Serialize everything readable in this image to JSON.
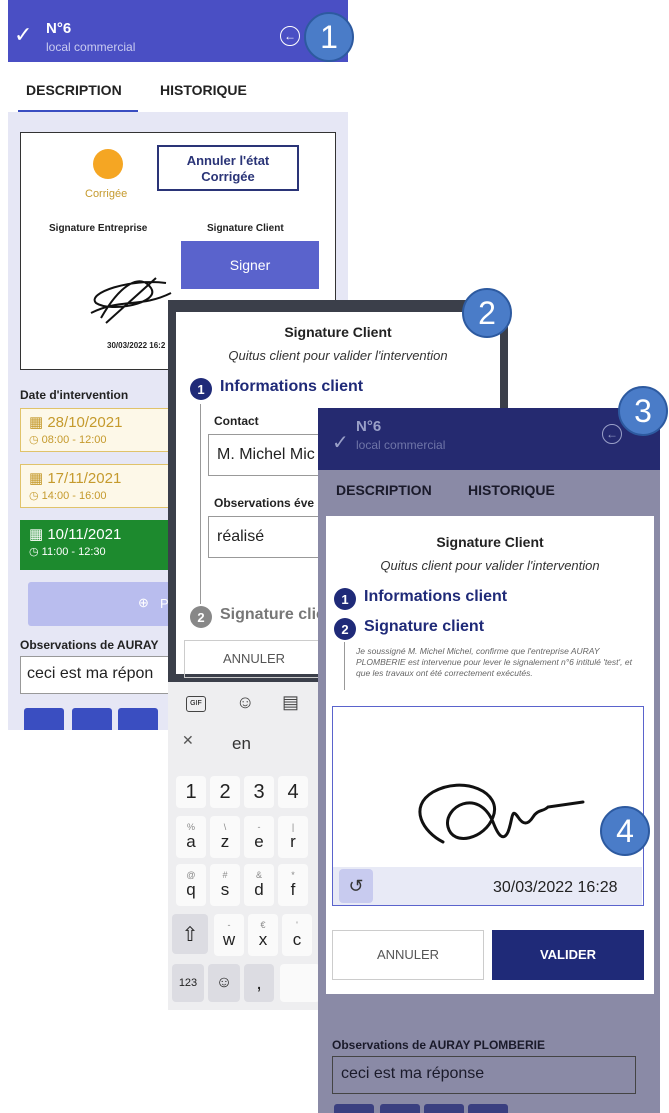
{
  "screen1": {
    "header": {
      "number": "N°6",
      "subtitle": "local commercial"
    },
    "tabs": [
      {
        "label": "DESCRIPTION"
      },
      {
        "label": "HISTORIQUE"
      }
    ],
    "status_label": "Corrigée",
    "cancel_button": "Annuler l'état Corrigée",
    "sig_company_label": "Signature Entreprise",
    "sig_client_label": "Signature Client",
    "sign_button": "Signer",
    "sig_timestamp": "30/03/2022 16:2",
    "date_heading": "Date d'intervention",
    "dates": [
      {
        "date": "28/10/2021",
        "time": "08:00 - 12:00"
      },
      {
        "date": "17/11/2021",
        "time": "14:00 - 16:00"
      },
      {
        "date": "10/11/2021",
        "time": "11:00 - 12:30"
      }
    ],
    "add_button": "Pr",
    "obs_heading": "Observations de AURAY",
    "obs_value": "ceci est ma répon"
  },
  "screen2": {
    "title": "Signature Client",
    "subtitle": "Quitus client pour valider l'intervention",
    "step1_num": "1",
    "step1_label": "Informations client",
    "contact_label": "Contact",
    "contact_value": "M. Michel Mic",
    "obs_label": "Observations éve",
    "obs_value": "réalisé",
    "step2_num": "2",
    "step2_label": "Signature clie",
    "cancel_button": "ANNULER"
  },
  "keyboard": {
    "lang": "en",
    "row_numbers": [
      "1",
      "2",
      "3",
      "4"
    ],
    "row_letters1": [
      {
        "main": "a",
        "sub": "%"
      },
      {
        "main": "z",
        "sub": "\\"
      },
      {
        "main": "e",
        "sub": "-"
      },
      {
        "main": "r",
        "sub": "|"
      }
    ],
    "row_letters2": [
      {
        "main": "q",
        "sub": "@"
      },
      {
        "main": "s",
        "sub": "#"
      },
      {
        "main": "d",
        "sub": "&"
      },
      {
        "main": "f",
        "sub": "*"
      }
    ],
    "row_letters3": [
      {
        "main": "w",
        "sub": "-"
      },
      {
        "main": "x",
        "sub": "€"
      },
      {
        "main": "c",
        "sub": "'"
      }
    ],
    "key_123": "123",
    "key_comma": ","
  },
  "screen3": {
    "header": {
      "number": "N°6",
      "subtitle": "local commercial"
    },
    "tabs": [
      {
        "label": "DESCRIPTION"
      },
      {
        "label": "HISTORIQUE"
      }
    ],
    "title": "Signature Client",
    "subtitle": "Quitus client pour valider l'intervention",
    "step1_num": "1",
    "step1_label": "Informations client",
    "step2_num": "2",
    "step2_label": "Signature client",
    "legal_text": "Je soussigné M. Michel Michel, confirme que l'entreprise AURAY PLOMBERIE est intervenue pour lever le signalement n°6 intitulé 'test', et que les travaux ont été correctement exécutés.",
    "timestamp": "30/03/2022 16:28",
    "cancel_button": "ANNULER",
    "validate_button": "VALIDER",
    "obs_heading": "Observations de AURAY PLOMBERIE",
    "obs_value": "ceci est ma réponse"
  },
  "bubbles": [
    "1",
    "2",
    "3",
    "4"
  ],
  "colors": {
    "header": "#4a4fc4",
    "navy": "#1f2a78",
    "green": "#1d8a2e",
    "accent_yellow": "#f5a623"
  }
}
